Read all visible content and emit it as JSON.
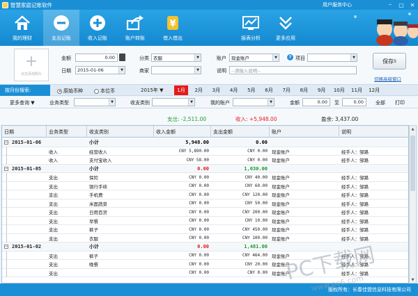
{
  "window": {
    "title": "智慧家庭记账软件",
    "user_center": "用户服务中心",
    "controls": [
      "⎯",
      "▢",
      "✕"
    ]
  },
  "toolbar": {
    "items": [
      {
        "label": "我的理财",
        "icon": "home-icon"
      },
      {
        "label": "支出记账",
        "icon": "minus-circle-icon",
        "active": true
      },
      {
        "label": "收入记账",
        "icon": "plus-circle-icon"
      },
      {
        "label": "账户转账",
        "icon": "transfer-icon"
      },
      {
        "label": "借入借出",
        "icon": "loan-exchange-icon"
      },
      {
        "label": "报表分析",
        "icon": "report-chart-icon"
      },
      {
        "label": "更多应用",
        "icon": "more-apps-icon"
      }
    ],
    "accent_color": "#1b8fd6"
  },
  "form": {
    "photo_hint": "点击添加照片",
    "amount_label": "金额",
    "amount_value": "0.00",
    "date_label": "日期",
    "date_value": "2015-01-06",
    "category_label": "分类",
    "category_value": "衣服",
    "merchant_label": "商家",
    "merchant_value": "",
    "account_label": "账户",
    "account_value": "现金账户",
    "project_label": "项目",
    "project_value": "",
    "remark_label": "说明",
    "remark_placeholder": "--请输入说明--",
    "save_label": "保存",
    "save_shortcut": "S",
    "adv_link": "切换高级窗口"
  },
  "month_bar": {
    "label": "按月份搜索:",
    "radio_original": "原始币种",
    "radio_base": "本位币",
    "year": "2015年",
    "months": [
      "1月",
      "2月",
      "3月",
      "4月",
      "5月",
      "6月",
      "7月",
      "8月",
      "9月",
      "10月",
      "11月",
      "12月"
    ],
    "active_month": "1月"
  },
  "filter": {
    "more_query": "更多查询",
    "biz_type_label": "业务类型",
    "category_label": "收支类别",
    "account_label": "我的账户",
    "amount_label": "金额",
    "amount_from": "0.00",
    "to_label": "至",
    "amount_to": "0.00",
    "all_label": "全部",
    "print_label": "打印"
  },
  "summary": {
    "expense_label": "支出:",
    "expense_value": "-2,511.00",
    "income_label": "收入:",
    "income_value": "+5,948.00",
    "balance_label": "盈余:",
    "balance_value": "3,437.00",
    "expense_color": "#1e9a2a",
    "income_color": "#e51b1b"
  },
  "grid": {
    "columns": [
      "日期",
      "业务类型",
      "收支类别",
      "收入金额",
      "支出金额",
      "账户",
      "说明"
    ],
    "rows": [
      {
        "kind": "group",
        "date": "2015-01-06",
        "category": "小计",
        "income": "5,948.00",
        "expense": "0.00",
        "income_color": "#000000",
        "expense_color": "#000000"
      },
      {
        "kind": "item",
        "type": "收入",
        "category": "经营收入",
        "income": "CNY 5,890.00",
        "expense": "CNY 0.00",
        "account": "现金账户",
        "note": "经手人：邹路"
      },
      {
        "kind": "item",
        "type": "收入",
        "category": "支付宝收入",
        "income": "CNY 58.00",
        "expense": "CNY 0.00",
        "account": "现金账户",
        "note": "经手人：邹路"
      },
      {
        "kind": "group",
        "date": "2015-01-05",
        "category": "小计",
        "income": "0.00",
        "expense": "1,030.00",
        "income_color": "#e51b1b",
        "expense_color": "#1e9a2a"
      },
      {
        "kind": "item",
        "type": "支出",
        "category": "保险",
        "income": "CNY 0.00",
        "expense": "CNY 40.00",
        "account": "现金账户",
        "note": "经手人：邹路"
      },
      {
        "kind": "item",
        "type": "支出",
        "category": "银行手续",
        "income": "CNY 0.00",
        "expense": "CNY 60.00",
        "account": "现金账户",
        "note": "经手人：邹路"
      },
      {
        "kind": "item",
        "type": "支出",
        "category": "手机费",
        "income": "CNY 0.00",
        "expense": "CNY 120.00",
        "account": "现金账户",
        "note": "经手人：邹路"
      },
      {
        "kind": "item",
        "type": "支出",
        "category": "米面蔬菜",
        "income": "CNY 0.00",
        "expense": "CNY 50.00",
        "account": "现金账户",
        "note": "经手人：邹路"
      },
      {
        "kind": "item",
        "type": "支出",
        "category": "日用百货",
        "income": "CNY 0.00",
        "expense": "CNY 200.00",
        "account": "现金账户",
        "note": "经手人：邹路"
      },
      {
        "kind": "item",
        "type": "支出",
        "category": "早餐",
        "income": "CNY 0.00",
        "expense": "CNY 10.00",
        "account": "现金账户",
        "note": "经手人：邹路"
      },
      {
        "kind": "item",
        "type": "支出",
        "category": "裤子",
        "income": "CNY 0.00",
        "expense": "CNY 450.00",
        "account": "现金账户",
        "note": "经手人：邹路"
      },
      {
        "kind": "item",
        "type": "支出",
        "category": "衣服",
        "income": "CNY 0.00",
        "expense": "CNY 100.00",
        "account": "现金账户",
        "note": "经手人：邹路"
      },
      {
        "kind": "group",
        "date": "2015-01-02",
        "category": "小计",
        "income": "0.00",
        "expense": "1,481.00",
        "income_color": "#e51b1b",
        "expense_color": "#1e9a2a"
      },
      {
        "kind": "item",
        "type": "支出",
        "category": "裤子",
        "income": "CNY 0.00",
        "expense": "CNY 464.00",
        "account": "现金账户",
        "note": "经手人：邹路"
      },
      {
        "kind": "item",
        "type": "支出",
        "category": "晚餐",
        "income": "CNY 0.00",
        "expense": "CNY 20.00",
        "account": "现金账户",
        "note": "经手人：邹路"
      },
      {
        "kind": "item",
        "type": "支出",
        "category": "",
        "income": "CNY 0.00",
        "expense": "CNY 0.00",
        "account": "现金账户",
        "note": "经手人：邹路"
      }
    ]
  },
  "status": {
    "copyright": "版权所有：长春佳盟信息科技有限公司"
  },
  "watermark": {
    "line1": "PC下载网",
    "line2": "www.pc6.com"
  }
}
